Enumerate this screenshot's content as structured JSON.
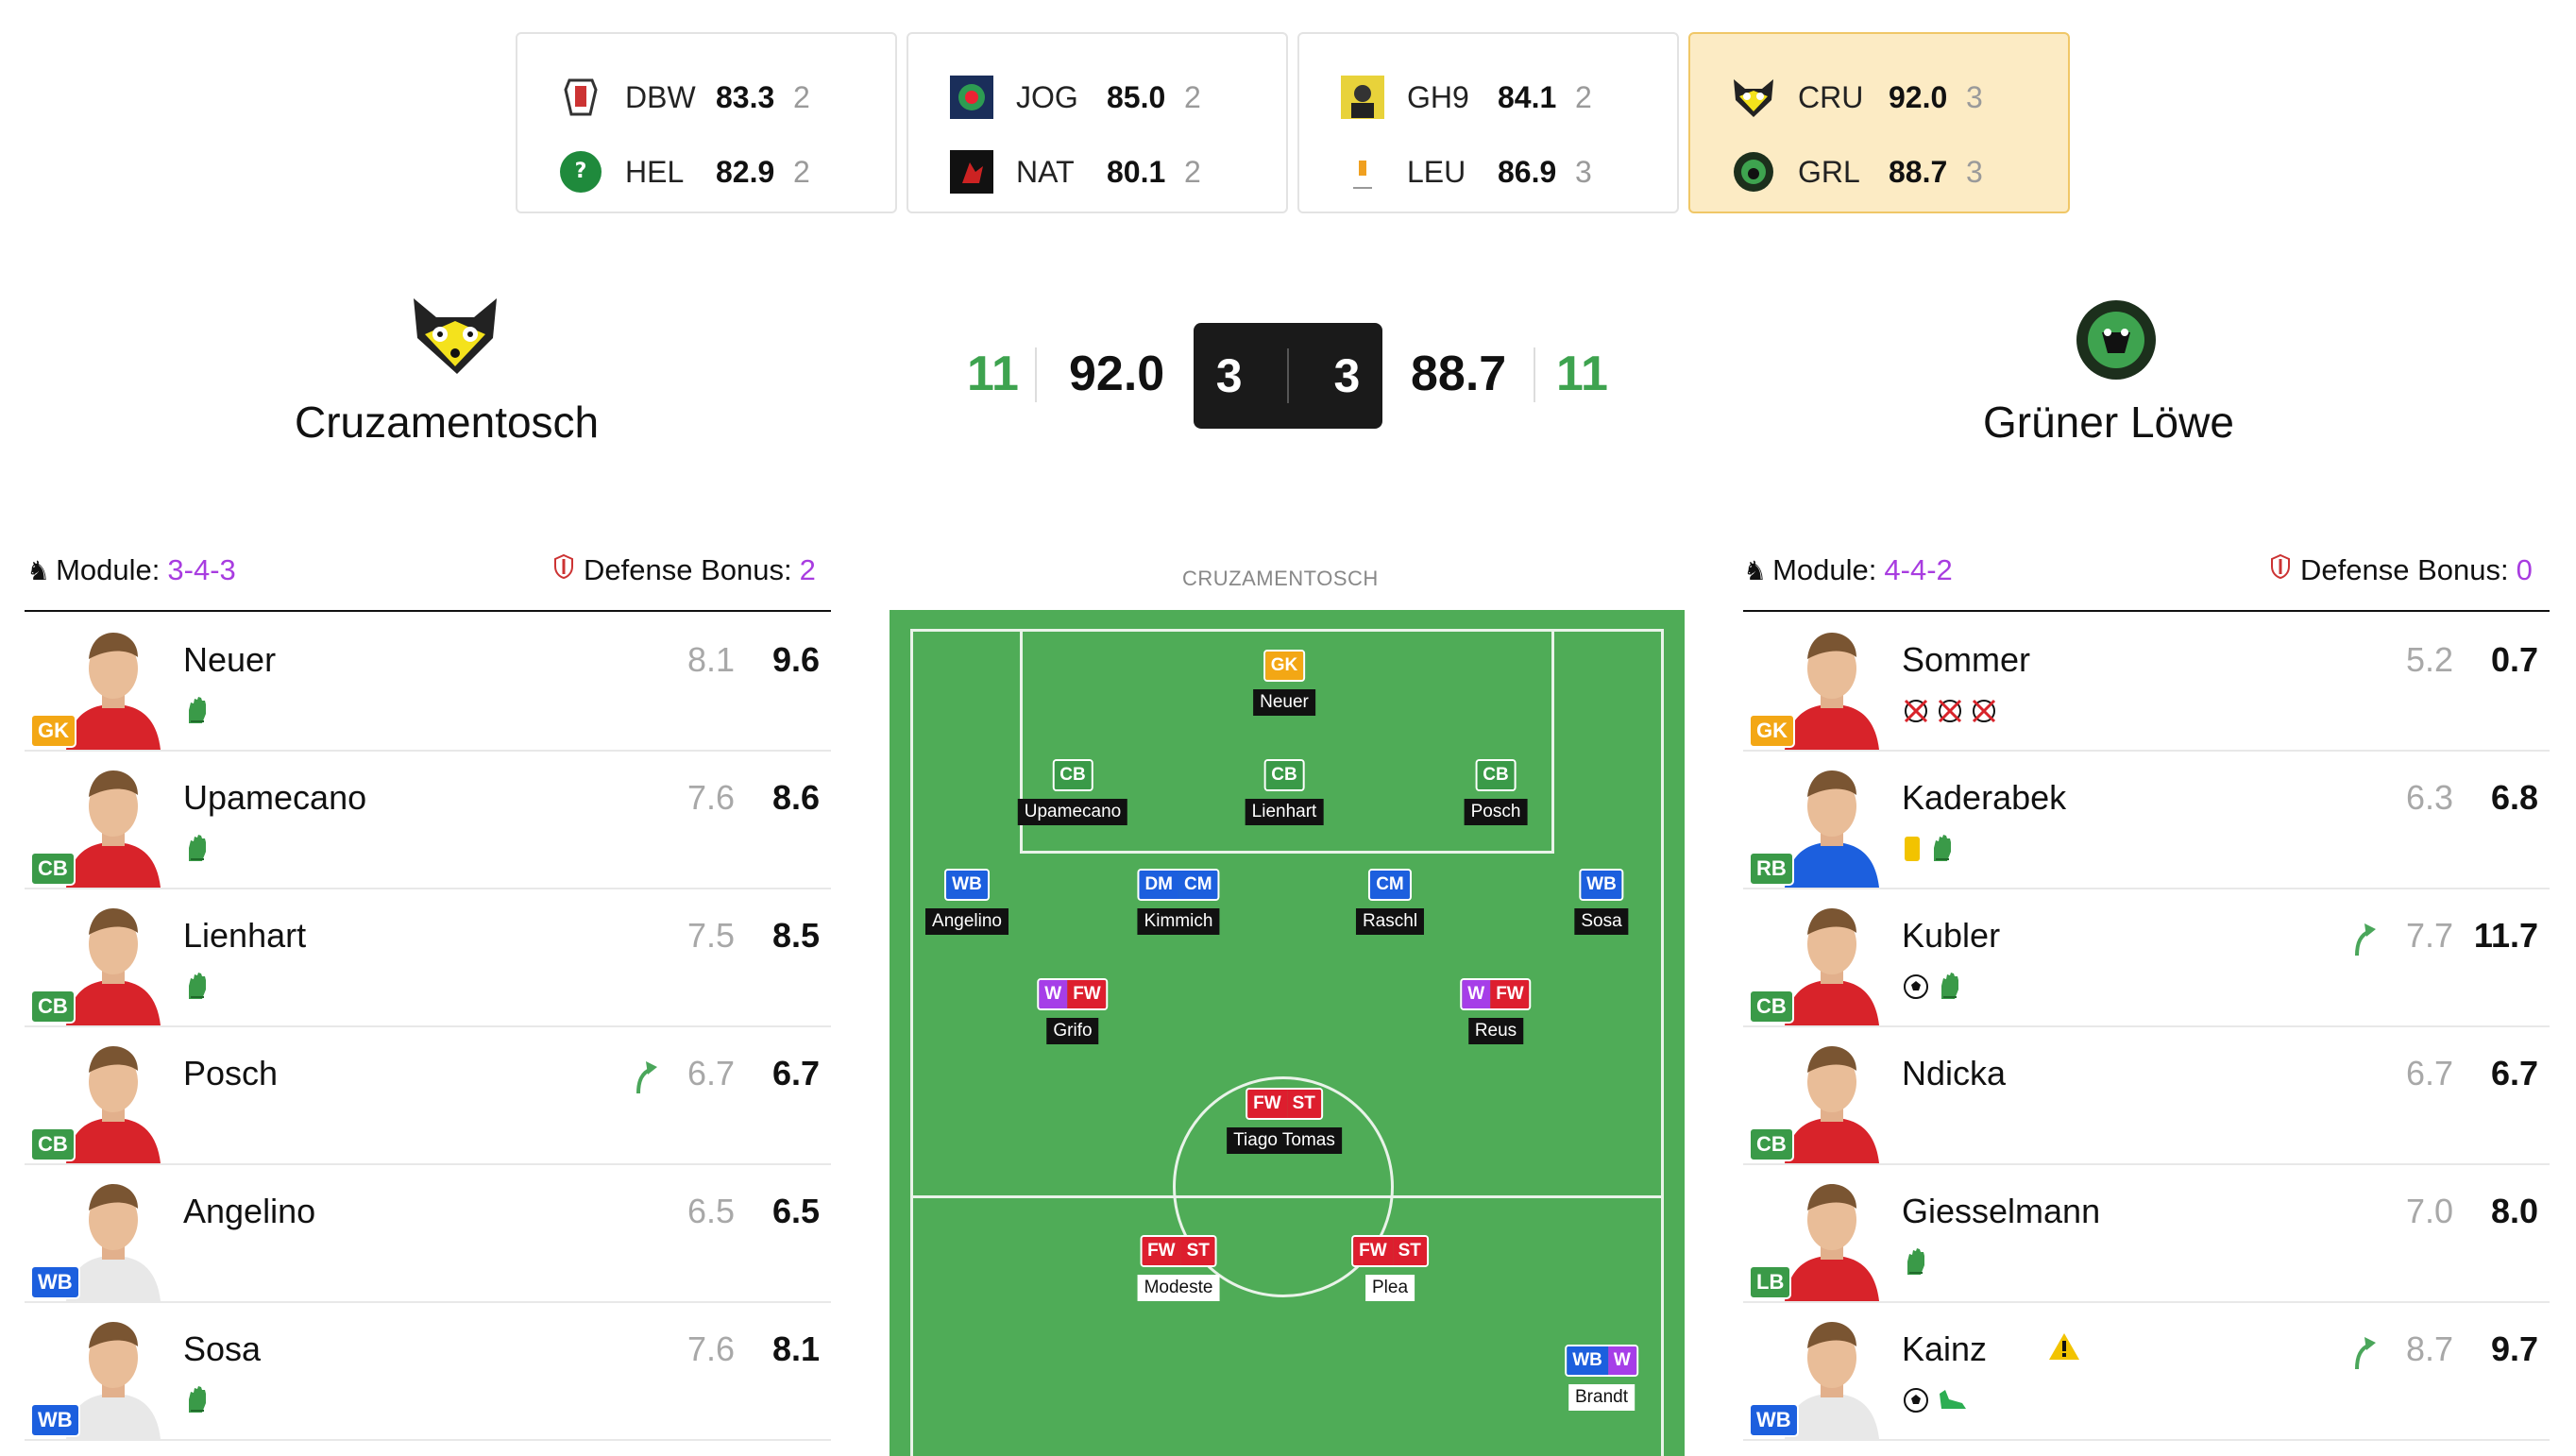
{
  "matches": [
    {
      "home": {
        "abbr": "DBW",
        "score": "83.3",
        "goals": "2"
      },
      "away": {
        "abbr": "HEL",
        "score": "82.9",
        "goals": "2"
      },
      "active": false
    },
    {
      "home": {
        "abbr": "JOG",
        "score": "85.0",
        "goals": "2"
      },
      "away": {
        "abbr": "NAT",
        "score": "80.1",
        "goals": "2"
      },
      "active": false
    },
    {
      "home": {
        "abbr": "GH9",
        "score": "84.1",
        "goals": "2"
      },
      "away": {
        "abbr": "LEU",
        "score": "86.9",
        "goals": "3"
      },
      "active": false
    },
    {
      "home": {
        "abbr": "CRU",
        "score": "92.0",
        "goals": "3"
      },
      "away": {
        "abbr": "GRL",
        "score": "88.7",
        "goals": "3"
      },
      "active": true
    }
  ],
  "header": {
    "home": {
      "name": "Cruzamentosch",
      "players": "11",
      "score": "92.0",
      "goals": "3"
    },
    "away": {
      "name": "Grüner Löwe",
      "players": "11",
      "score": "88.7",
      "goals": "3"
    }
  },
  "home_panel": {
    "module_label": "Module:",
    "module": "3-4-3",
    "defense_label": "Defense Bonus:",
    "defense": "2",
    "players": [
      {
        "name": "Neuer",
        "role": "GK",
        "vote": "8.1",
        "final": "9.6",
        "icons": [
          "glove-icon"
        ],
        "sub_in": false
      },
      {
        "name": "Upamecano",
        "role": "CB",
        "vote": "7.6",
        "final": "8.6",
        "icons": [
          "glove-icon"
        ],
        "sub_in": false
      },
      {
        "name": "Lienhart",
        "role": "CB",
        "vote": "7.5",
        "final": "8.5",
        "icons": [
          "glove-icon"
        ],
        "sub_in": false
      },
      {
        "name": "Posch",
        "role": "CB",
        "vote": "6.7",
        "final": "6.7",
        "icons": [],
        "sub_in": true
      },
      {
        "name": "Angelino",
        "role": "WB",
        "vote": "6.5",
        "final": "6.5",
        "icons": [],
        "sub_in": false
      },
      {
        "name": "Sosa",
        "role": "WB",
        "vote": "7.6",
        "final": "8.1",
        "icons": [
          "glove-icon"
        ],
        "sub_in": false
      }
    ]
  },
  "away_panel": {
    "module_label": "Module:",
    "module": "4-4-2",
    "defense_label": "Defense Bonus:",
    "defense": "0",
    "players": [
      {
        "name": "Sommer",
        "role": "GK",
        "vote": "5.2",
        "final": "0.7",
        "icons": [
          "goal-conceded-icon",
          "goal-conceded-icon",
          "goal-conceded-icon"
        ],
        "sub_in": false
      },
      {
        "name": "Kaderabek",
        "role": "RB",
        "vote": "6.3",
        "final": "6.8",
        "icons": [
          "yellow-card-icon",
          "glove-icon"
        ],
        "sub_in": false
      },
      {
        "name": "Kubler",
        "role": "CB",
        "vote": "7.7",
        "final": "11.7",
        "icons": [
          "ball-icon",
          "glove-icon"
        ],
        "sub_in": true
      },
      {
        "name": "Ndicka",
        "role": "CB",
        "vote": "6.7",
        "final": "6.7",
        "icons": [],
        "sub_in": false
      },
      {
        "name": "Giesselmann",
        "role": "LB",
        "vote": "7.0",
        "final": "8.0",
        "icons": [
          "glove-icon"
        ],
        "sub_in": false
      },
      {
        "name": "Kainz",
        "role": "WB",
        "vote": "8.7",
        "final": "9.7",
        "icons": [
          "ball-icon",
          "assist-boot-icon"
        ],
        "sub_in": true,
        "warning": true
      }
    ]
  },
  "pitch": {
    "title": "CRUZAMENTOSCH",
    "players": [
      {
        "name": "Neuer",
        "roles": [
          "GK"
        ]
      },
      {
        "name": "Upamecano",
        "roles": [
          "CB"
        ]
      },
      {
        "name": "Lienhart",
        "roles": [
          "CB"
        ]
      },
      {
        "name": "Posch",
        "roles": [
          "CB"
        ]
      },
      {
        "name": "Angelino",
        "roles": [
          "WB"
        ]
      },
      {
        "name": "Kimmich",
        "roles": [
          "DM",
          "CM"
        ]
      },
      {
        "name": "Raschl",
        "roles": [
          "CM"
        ]
      },
      {
        "name": "Sosa",
        "roles": [
          "WB"
        ]
      },
      {
        "name": "Grifo",
        "roles": [
          "W",
          "FW"
        ]
      },
      {
        "name": "Reus",
        "roles": [
          "W",
          "FW"
        ]
      },
      {
        "name": "Tiago Tomas",
        "roles": [
          "FW",
          "ST"
        ]
      },
      {
        "name": "Modeste",
        "roles": [
          "FW",
          "ST"
        ],
        "opponent": true
      },
      {
        "name": "Plea",
        "roles": [
          "FW",
          "ST"
        ],
        "opponent": true
      },
      {
        "name": "Brandt",
        "roles": [
          "WB",
          "W"
        ],
        "opponent": true
      }
    ]
  },
  "colors": {
    "green": "#3ea34f",
    "purple": "#a83ce0",
    "pitch": "#4fac57",
    "active_card": "#fcebc4"
  }
}
